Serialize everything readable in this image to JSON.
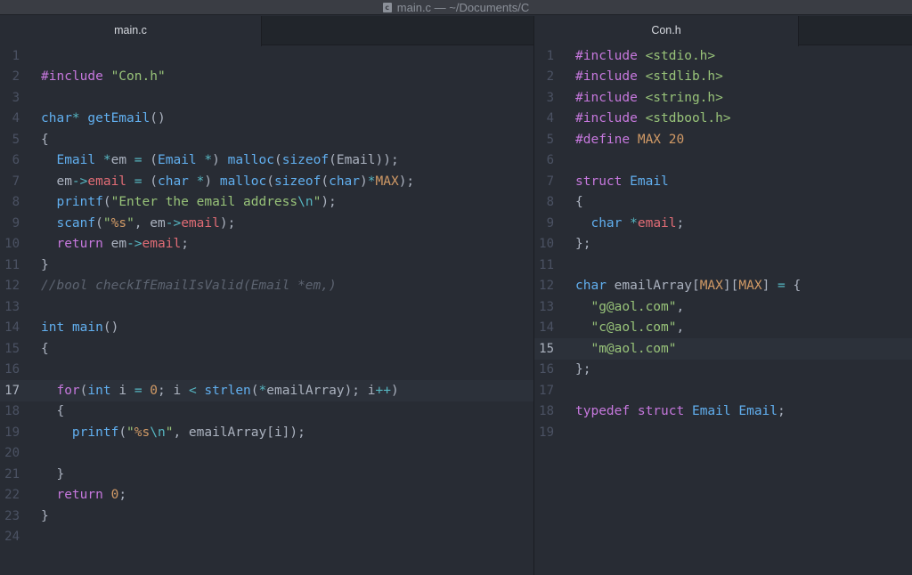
{
  "window": {
    "title": "main.c — ~/Documents/C",
    "file_icon_letter": "c"
  },
  "colors": {
    "keyword": "#c678dd",
    "type": "#61afef",
    "string": "#98c379",
    "number": "#d19a66",
    "member": "#e06c75",
    "operator": "#56b6c2",
    "comment": "#5c6370",
    "text": "#abb2bf"
  },
  "left": {
    "tab": "main.c",
    "active_line": 17,
    "lines": [
      [],
      [
        [
          "kw",
          "#include"
        ],
        [
          "tx",
          " "
        ],
        [
          "str",
          "\"Con.h\""
        ]
      ],
      [],
      [
        [
          "ty",
          "char"
        ],
        [
          "op",
          "*"
        ],
        [
          "tx",
          " "
        ],
        [
          "fn",
          "getEmail"
        ],
        [
          "tx",
          "()"
        ]
      ],
      [
        [
          "tx",
          "{"
        ]
      ],
      [
        [
          "tx",
          "  "
        ],
        [
          "ty",
          "Email"
        ],
        [
          "tx",
          " "
        ],
        [
          "op",
          "*"
        ],
        [
          "tx",
          "em "
        ],
        [
          "op",
          "="
        ],
        [
          "tx",
          " ("
        ],
        [
          "ty",
          "Email"
        ],
        [
          "tx",
          " "
        ],
        [
          "op",
          "*"
        ],
        [
          "tx",
          ") "
        ],
        [
          "fn",
          "malloc"
        ],
        [
          "tx",
          "("
        ],
        [
          "fn",
          "sizeof"
        ],
        [
          "tx",
          "(Email));"
        ]
      ],
      [
        [
          "tx",
          "  em"
        ],
        [
          "op",
          "->"
        ],
        [
          "mem",
          "email"
        ],
        [
          "tx",
          " "
        ],
        [
          "op",
          "="
        ],
        [
          "tx",
          " ("
        ],
        [
          "ty",
          "char"
        ],
        [
          "tx",
          " "
        ],
        [
          "op",
          "*"
        ],
        [
          "tx",
          ") "
        ],
        [
          "fn",
          "malloc"
        ],
        [
          "tx",
          "("
        ],
        [
          "fn",
          "sizeof"
        ],
        [
          "tx",
          "("
        ],
        [
          "ty",
          "char"
        ],
        [
          "tx",
          ")"
        ],
        [
          "op",
          "*"
        ],
        [
          "mac",
          "MAX"
        ],
        [
          "tx",
          ");"
        ]
      ],
      [
        [
          "tx",
          "  "
        ],
        [
          "fn",
          "printf"
        ],
        [
          "tx",
          "("
        ],
        [
          "str",
          "\"Enter the email address"
        ],
        [
          "esc",
          "\\n"
        ],
        [
          "str",
          "\""
        ],
        [
          "tx",
          ");"
        ]
      ],
      [
        [
          "tx",
          "  "
        ],
        [
          "fn",
          "scanf"
        ],
        [
          "tx",
          "("
        ],
        [
          "str",
          "\""
        ],
        [
          "num",
          "%s"
        ],
        [
          "str",
          "\""
        ],
        [
          "tx",
          ", em"
        ],
        [
          "op",
          "->"
        ],
        [
          "mem",
          "email"
        ],
        [
          "tx",
          ");"
        ]
      ],
      [
        [
          "tx",
          "  "
        ],
        [
          "kw",
          "return"
        ],
        [
          "tx",
          " em"
        ],
        [
          "op",
          "->"
        ],
        [
          "mem",
          "email"
        ],
        [
          "tx",
          ";"
        ]
      ],
      [
        [
          "tx",
          "}"
        ]
      ],
      [
        [
          "cm",
          "//bool checkIfEmailIsValid(Email *em,)"
        ]
      ],
      [],
      [
        [
          "ty",
          "int"
        ],
        [
          "tx",
          " "
        ],
        [
          "fn",
          "main"
        ],
        [
          "tx",
          "()"
        ]
      ],
      [
        [
          "tx",
          "{"
        ]
      ],
      [],
      [
        [
          "tx",
          "  "
        ],
        [
          "kw",
          "for"
        ],
        [
          "tx",
          "("
        ],
        [
          "ty",
          "int"
        ],
        [
          "tx",
          " i "
        ],
        [
          "op",
          "="
        ],
        [
          "tx",
          " "
        ],
        [
          "num",
          "0"
        ],
        [
          "tx",
          "; i "
        ],
        [
          "op",
          "<"
        ],
        [
          "tx",
          " "
        ],
        [
          "fn",
          "strlen"
        ],
        [
          "tx",
          "("
        ],
        [
          "op",
          "*"
        ],
        [
          "tx",
          "emailArray); i"
        ],
        [
          "op",
          "++"
        ],
        [
          "tx",
          ")"
        ]
      ],
      [
        [
          "tx",
          "  {"
        ]
      ],
      [
        [
          "tx",
          "    "
        ],
        [
          "fn",
          "printf"
        ],
        [
          "tx",
          "("
        ],
        [
          "str",
          "\""
        ],
        [
          "num",
          "%s"
        ],
        [
          "esc",
          "\\n"
        ],
        [
          "str",
          "\""
        ],
        [
          "tx",
          ", emailArray[i]);"
        ]
      ],
      [],
      [
        [
          "tx",
          "  }"
        ]
      ],
      [
        [
          "tx",
          "  "
        ],
        [
          "kw",
          "return"
        ],
        [
          "tx",
          " "
        ],
        [
          "num",
          "0"
        ],
        [
          "tx",
          ";"
        ]
      ],
      [
        [
          "tx",
          "}"
        ]
      ],
      []
    ]
  },
  "right": {
    "tab": "Con.h",
    "active_line": 15,
    "lines": [
      [
        [
          "kw",
          "#include"
        ],
        [
          "tx",
          " "
        ],
        [
          "str",
          "<stdio.h>"
        ]
      ],
      [
        [
          "kw",
          "#include"
        ],
        [
          "tx",
          " "
        ],
        [
          "str",
          "<stdlib.h>"
        ]
      ],
      [
        [
          "kw",
          "#include"
        ],
        [
          "tx",
          " "
        ],
        [
          "str",
          "<string.h>"
        ]
      ],
      [
        [
          "kw",
          "#include"
        ],
        [
          "tx",
          " "
        ],
        [
          "str",
          "<stdbool.h>"
        ]
      ],
      [
        [
          "kw",
          "#define"
        ],
        [
          "tx",
          " "
        ],
        [
          "mac",
          "MAX"
        ],
        [
          "tx",
          " "
        ],
        [
          "num",
          "20"
        ]
      ],
      [],
      [
        [
          "kw",
          "struct"
        ],
        [
          "tx",
          " "
        ],
        [
          "ty",
          "Email"
        ]
      ],
      [
        [
          "tx",
          "{"
        ]
      ],
      [
        [
          "tx",
          "  "
        ],
        [
          "ty",
          "char"
        ],
        [
          "tx",
          " "
        ],
        [
          "op",
          "*"
        ],
        [
          "mem",
          "email"
        ],
        [
          "tx",
          ";"
        ]
      ],
      [
        [
          "tx",
          "};"
        ]
      ],
      [],
      [
        [
          "ty",
          "char"
        ],
        [
          "tx",
          " emailArray["
        ],
        [
          "mac",
          "MAX"
        ],
        [
          "tx",
          "]["
        ],
        [
          "mac",
          "MAX"
        ],
        [
          "tx",
          "] "
        ],
        [
          "op",
          "="
        ],
        [
          "tx",
          " {"
        ]
      ],
      [
        [
          "tx",
          "  "
        ],
        [
          "str",
          "\"g@aol.com\""
        ],
        [
          "tx",
          ","
        ]
      ],
      [
        [
          "tx",
          "  "
        ],
        [
          "str",
          "\"c@aol.com\""
        ],
        [
          "tx",
          ","
        ]
      ],
      [
        [
          "tx",
          "  "
        ],
        [
          "str",
          "\"m@aol.com\""
        ]
      ],
      [
        [
          "tx",
          "};"
        ]
      ],
      [],
      [
        [
          "kw",
          "typedef"
        ],
        [
          "tx",
          " "
        ],
        [
          "kw",
          "struct"
        ],
        [
          "tx",
          " "
        ],
        [
          "ty",
          "Email"
        ],
        [
          "tx",
          " "
        ],
        [
          "ty",
          "Email"
        ],
        [
          "tx",
          ";"
        ]
      ],
      []
    ]
  }
}
